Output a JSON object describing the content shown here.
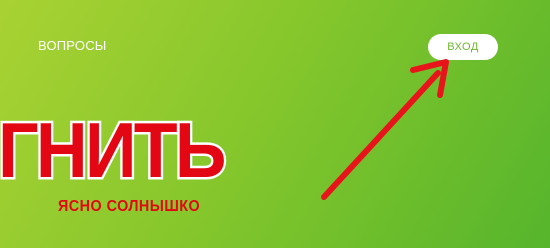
{
  "header": {
    "nav_link": "ВОПРОСЫ",
    "login_label": "ВХОД"
  },
  "logo": {
    "word": "ГНИТЬ",
    "tagline": "ЯСНО СОЛНЫШКО"
  },
  "colors": {
    "background_start": "#a9d233",
    "background_end": "#56b52c",
    "brand_red": "#e30613",
    "annotation_arrow": "#e8141c"
  },
  "annotation": {
    "icon": "red-arrow-icon",
    "points_to": "login-button"
  }
}
